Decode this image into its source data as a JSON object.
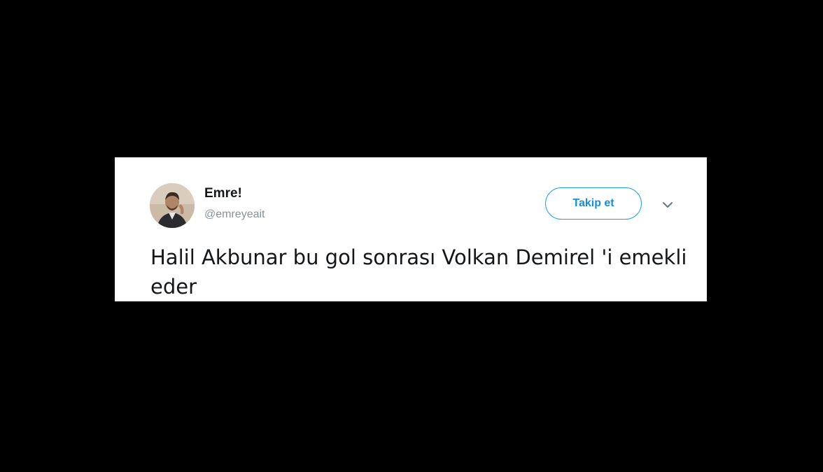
{
  "tweet": {
    "display_name": "Emre!",
    "handle": "@emreyeait",
    "follow_label": "Takip et",
    "text": "Halil Akbunar bu gol sonrası Volkan Demirel 'i emekli eder",
    "more_icon": "chevron-down-icon",
    "avatar_icon": "user-avatar-photo"
  },
  "colors": {
    "page_background": "#000000",
    "card_background": "#ffffff",
    "accent": "#1da1f2",
    "name_text": "#14171a",
    "handle_text": "#8a9299"
  }
}
